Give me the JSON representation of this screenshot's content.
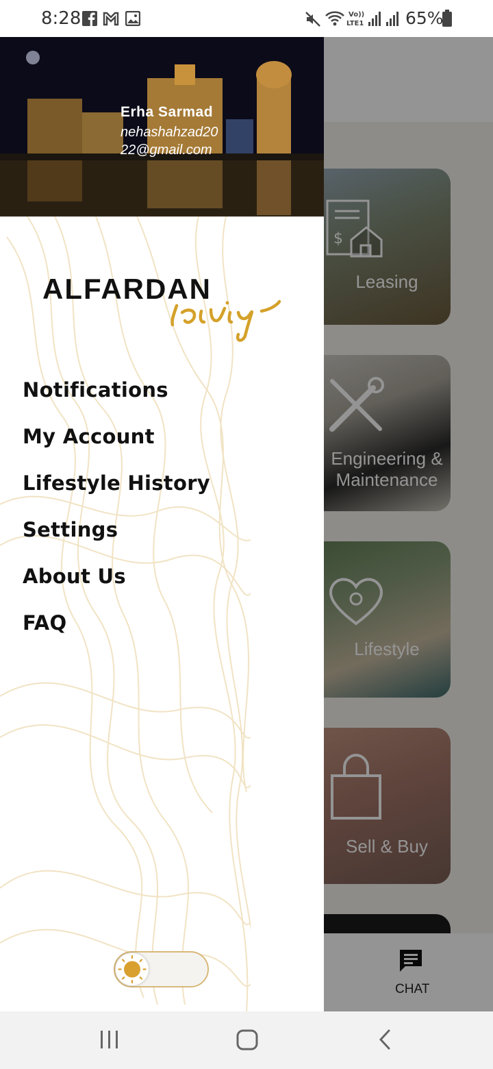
{
  "status_bar": {
    "time": "8:28",
    "battery": "65%",
    "left_icons": [
      "facebook-icon",
      "gmail-icon",
      "gallery-icon"
    ],
    "right_icons": [
      "mute-icon",
      "wifi-icon",
      "volte-icon",
      "signal-icon",
      "signal-icon",
      "battery-icon"
    ]
  },
  "drawer": {
    "user": {
      "name": "Erha Sarmad",
      "email": "nehashahzad2022@gmail.com"
    },
    "brand": {
      "primary": "ALFARDAN",
      "script": "Living",
      "accent_color": "#d4a12a"
    },
    "menu": [
      {
        "label": "Notifications"
      },
      {
        "label": "My Account"
      },
      {
        "label": "Lifestyle History"
      },
      {
        "label": "Settings"
      },
      {
        "label": "About Us"
      },
      {
        "label": "FAQ"
      }
    ],
    "theme_toggle": {
      "icon": "sun-icon",
      "state": "light"
    }
  },
  "background_app": {
    "cards": [
      {
        "label": "Leasing",
        "icon": "lease-house-icon"
      },
      {
        "label": "Engineering & Maintenance",
        "icon": "tools-icon"
      },
      {
        "label": "Lifestyle",
        "icon": "heart-icon"
      },
      {
        "label": "Sell & Buy",
        "icon": "shopping-bag-icon"
      }
    ],
    "chat_label": "CHAT"
  },
  "nav_bar": {
    "buttons": [
      "recents-icon",
      "home-icon",
      "back-icon"
    ]
  },
  "colors": {
    "accent": "#d4a12a",
    "menu_text": "#111111",
    "scrim": "rgba(0,0,0,0.42)"
  }
}
